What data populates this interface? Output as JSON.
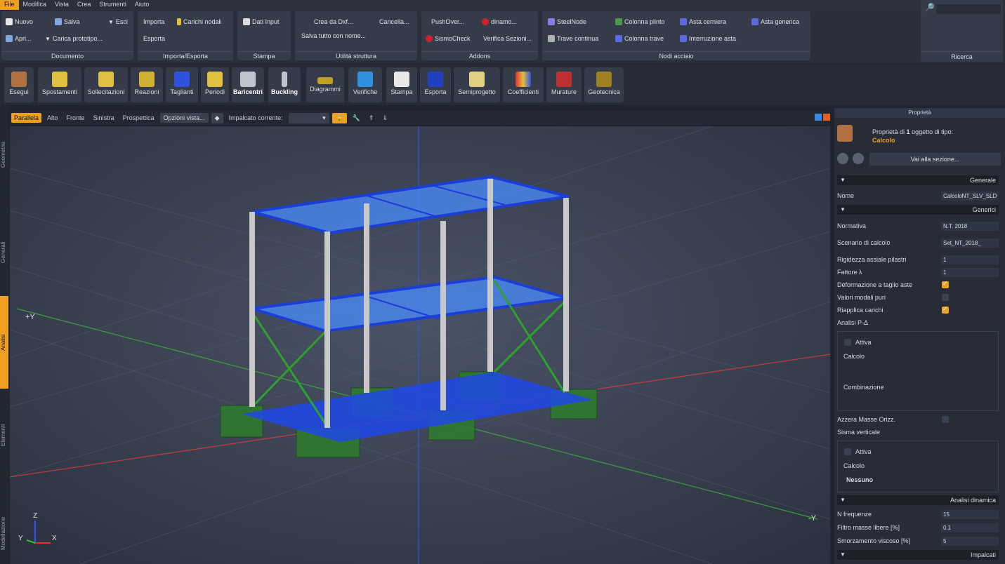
{
  "menu": [
    "File",
    "Modifica",
    "Vista",
    "Crea",
    "Strumenti",
    "Aiuto"
  ],
  "ribbon": {
    "documento": {
      "label": "Documento",
      "nuovo": "Nuovo",
      "salva": "Salva",
      "esci": "Esci",
      "apri": "Apri...",
      "carica": "Carica prototipo..."
    },
    "importa": {
      "label": "Importa/Esporta",
      "importa": "Importa",
      "carichi": "Carichi nodali",
      "esporta": "Esporta"
    },
    "stampa": {
      "label": "Stampa",
      "dati": "Dati Input"
    },
    "utilita": {
      "label": "Utilità struttura",
      "crea": "Crea da Dxf...",
      "cancella": "Cancella...",
      "salva": "Salva tutto con nome..."
    },
    "addons": {
      "label": "Addons",
      "push": "PushOver...",
      "dinamo": "dinamo...",
      "sismo": "SismoCheck",
      "verifica": "Verifica Sezioni..."
    },
    "nodi": {
      "label": "Nodi acciaio",
      "steel": "SteelNode",
      "colplinto": "Colonna plinto",
      "astacer": "Asta cerniera",
      "astagen": "Asta generica",
      "travec": "Trave continua",
      "coltrave": "Colonna trave",
      "interr": "Interruzione asta"
    },
    "ricerca": {
      "label": "Ricerca"
    }
  },
  "toolbar": [
    "Esegui",
    "Spostamenti",
    "Sollecitazioni",
    "Reazioni",
    "Taglianti",
    "Periodi",
    "Baricentri",
    "Buckling",
    "Diagrammi",
    "Verifiche",
    "Stampa",
    "Esporta",
    "Semiprogetto",
    "Coefficienti",
    "Murature",
    "Geotecnica"
  ],
  "viewbar": {
    "tabs": [
      "Parallela",
      "Alto",
      "Fronte",
      "Sinistra",
      "Prospettica"
    ],
    "opzioni": "Opzioni vista...",
    "impalcato": "Impalcato corrente:"
  },
  "leftstrip": [
    "Geometrie",
    "Generali",
    "Analisi",
    "Elementi",
    "Modellazione"
  ],
  "viewport": {
    "plusY": "+Y",
    "minusY": "-Y",
    "axZ": "Z",
    "axY": "Y",
    "axX": "X"
  },
  "panel": {
    "title": "Proprietà",
    "header1": "Proprietà di",
    "count": "1",
    "header2": "oggetto di tipo:",
    "type": "Calcolo",
    "vai": "Vai alla sezione...",
    "generale": "Generale",
    "nome_l": "Nome",
    "nome_v": "CalcoloNT_SLV_SLD",
    "generici": "Generici",
    "normativa_l": "Normativa",
    "normativa_v": "N.T. 2018",
    "scenario_l": "Scenario di calcolo",
    "scenario_v": "Set_NT_2018_",
    "rigidezza_l": "Rigidezza assiale pilastri",
    "rigidezza_v": "1",
    "fattore_l": "Fattore λ",
    "fattore_v": "1",
    "deform_l": "Deformazione a taglio aste",
    "valori_l": "Valori modali puri",
    "riapplica_l": "Riapplica carichi",
    "pdelta_l": "Analisi P-Δ",
    "attiva": "Attiva",
    "calcolo": "Calcolo",
    "combinazione": "Combinazione",
    "azzera_l": "Azzera Masse Orizz.",
    "sisma_l": "Sisma verticale",
    "nessuno": "Nessuno",
    "dinamica": "Analisi dinamica",
    "nfreq_l": "N frequenze",
    "nfreq_v": "15",
    "filtro_l": "Filtro masse libere [%]",
    "filtro_v": "0.1",
    "smorz_l": "Smorzamento viscoso [%]",
    "smorz_v": "5",
    "impalcati": "Impalcati"
  },
  "colors": {
    "accent": "#f0a020",
    "slab": "#4a8cff",
    "beam": "#1a3fd8",
    "column": "#c8c8c8",
    "brace": "#2ea02e",
    "footing": "#2f7a2f"
  }
}
